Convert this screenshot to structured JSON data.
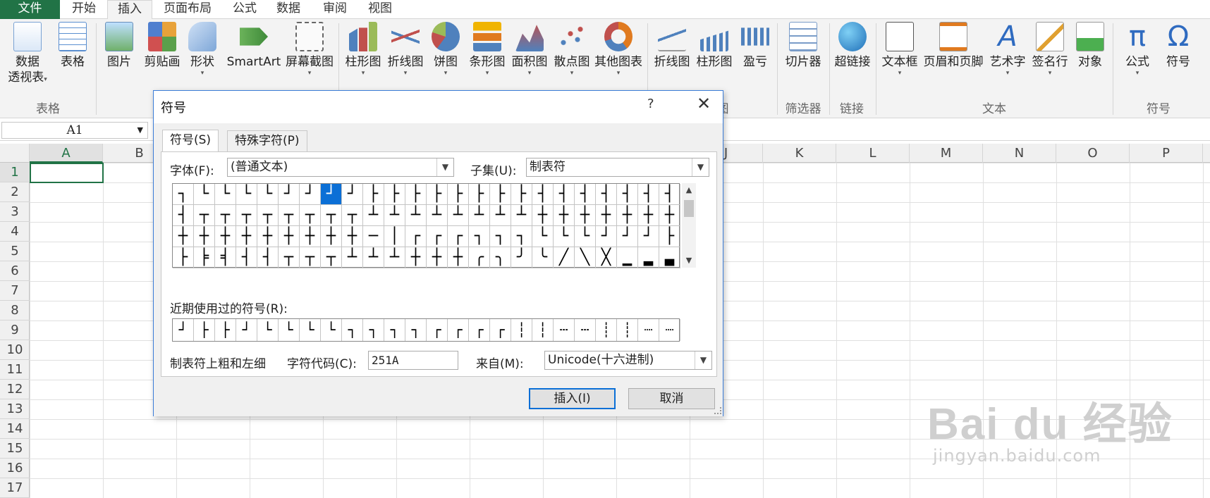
{
  "ribbon_tabs": [
    "文件",
    "开始",
    "插入",
    "页面布局",
    "公式",
    "数据",
    "审阅",
    "视图"
  ],
  "ribbon": {
    "buttons": {
      "pivot_line1": "数据",
      "pivot_line2": "透视表",
      "table": "表格",
      "picture": "图片",
      "clipart": "剪贴画",
      "shapes": "形状",
      "smartart": "SmartArt",
      "screenshot": "屏幕截图",
      "column_chart": "柱形图",
      "line_chart": "折线图",
      "pie_chart": "饼图",
      "bar_chart": "条形图",
      "area_chart": "面积图",
      "scatter_chart": "散点图",
      "other_charts": "其他图表",
      "spark_line": "折线图",
      "spark_column": "柱形图",
      "spark_winloss": "盈亏",
      "slicer": "切片器",
      "hyperlink": "超链接",
      "textbox": "文本框",
      "header_footer": "页眉和页脚",
      "wordart": "艺术字",
      "signature": "签名行",
      "object": "对象",
      "equation": "公式",
      "symbol": "符号"
    },
    "groups": {
      "tables": "表格",
      "charts_tail": "图",
      "filter": "筛选器",
      "links": "链接",
      "text": "文本",
      "symbols": "符号"
    },
    "icons": {
      "pivot": "pivot-table-icon",
      "table": "table-icon",
      "picture": "picture-icon",
      "clipart": "clipart-icon",
      "shapes": "shapes-icon",
      "smartart": "smartart-icon",
      "screenshot": "screenshot-icon",
      "column": "column-chart-icon",
      "line": "line-chart-icon",
      "pie": "pie-chart-icon",
      "bar": "bar-chart-icon",
      "area": "area-chart-icon",
      "scatter": "scatter-chart-icon",
      "other": "donut-chart-icon"
    }
  },
  "formula_bar": {
    "name_box": "A1"
  },
  "grid": {
    "columns": [
      "A",
      "B",
      "C",
      "D",
      "E",
      "F",
      "G",
      "H",
      "I",
      "J",
      "K",
      "L",
      "M",
      "N",
      "O",
      "P"
    ],
    "rows": [
      "1",
      "2",
      "3",
      "4",
      "5",
      "6",
      "7",
      "8",
      "9",
      "10",
      "11",
      "12",
      "13",
      "14",
      "15",
      "16",
      "17"
    ],
    "selected_cell": "A1"
  },
  "dialog": {
    "title": "符号",
    "help": "?",
    "close": "✕",
    "tabs": [
      "符号(S)",
      "特殊字符(P)"
    ],
    "font_label": "字体(F):",
    "font_value": "(普通文本)",
    "subset_label": "子集(U):",
    "subset_value": "制表符",
    "symbols": [
      "┐",
      "└",
      "└",
      "└",
      "└",
      "┘",
      "┘",
      "┘",
      "┘",
      "├",
      "├",
      "├",
      "├",
      "├",
      "├",
      "├",
      "├",
      "┤",
      "┤",
      "┤",
      "┤",
      "┤",
      "┤",
      "┤",
      "┤",
      "┬",
      "┬",
      "┬",
      "┬",
      "┬",
      "┬",
      "┬",
      "┬",
      "┴",
      "┴",
      "┴",
      "┴",
      "┴",
      "┴",
      "┴",
      "┴",
      "┼",
      "┼",
      "┼",
      "┼",
      "┼",
      "┼",
      "┼",
      "┼",
      "┼",
      "┼",
      "┼",
      "┼",
      "┼",
      "┼",
      "┼",
      "┼",
      "─",
      "│",
      "┌",
      "┌",
      "┌",
      "┐",
      "┐",
      "┐",
      "└",
      "└",
      "└",
      "┘",
      "┘",
      "┘",
      "├",
      "├",
      "╞",
      "╡",
      "┤",
      "┤",
      "┬",
      "┬",
      "┬",
      "┴",
      "┴",
      "┴",
      "┼",
      "┼",
      "┼",
      "╭",
      "╮",
      "╯",
      "╰",
      "╱",
      "╲",
      "╳",
      "▁",
      "▂",
      "▃"
    ],
    "selected_symbol": "┘",
    "recent_label": "近期使用过的符号(R):",
    "recent_symbols": [
      "┘",
      "├",
      "├",
      "┘",
      "└",
      "└",
      "└",
      "└",
      "┐",
      "┐",
      "┐",
      "┐",
      "┌",
      "┌",
      "┌",
      "┌",
      "┆",
      "┆",
      "┄",
      "┄",
      "┊",
      "┊",
      "┈",
      "┈"
    ],
    "symbol_name": "制表符上粗和左细",
    "code_label": "字符代码(C):",
    "code_value": "251A",
    "from_label": "来自(M):",
    "from_value": "Unicode(十六进制)",
    "insert_button": "插入(I)",
    "cancel_button": "取消"
  },
  "watermark": {
    "brand": "Bai du 经验",
    "url": "jingyan.baidu.com"
  },
  "colors": {
    "excel_green": "#217346",
    "selection_blue": "#0b6fd6"
  }
}
